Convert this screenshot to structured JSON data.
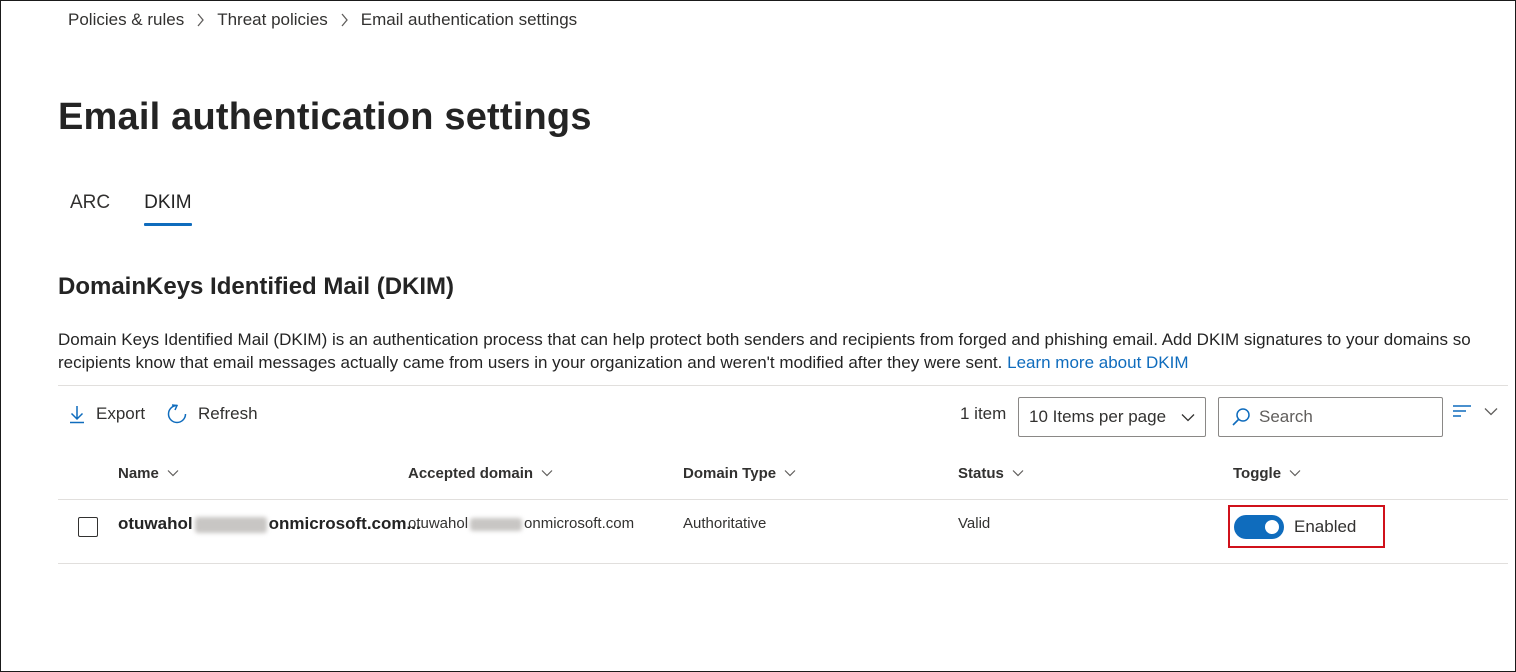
{
  "breadcrumb": {
    "items": [
      "Policies & rules",
      "Threat policies",
      "Email authentication settings"
    ]
  },
  "page": {
    "title": "Email authentication settings"
  },
  "tabs": [
    {
      "label": "ARC",
      "active": false
    },
    {
      "label": "DKIM",
      "active": true
    }
  ],
  "section": {
    "title": "DomainKeys Identified Mail (DKIM)",
    "description": "Domain Keys Identified Mail (DKIM) is an authentication process that can help protect both senders and recipients from forged and phishing email. Add DKIM signatures to your domains so recipients know that email messages actually came from users in your organization and weren't modified after they were sent.",
    "learn_more": "Learn more about DKIM"
  },
  "toolbar": {
    "export_label": "Export",
    "refresh_label": "Refresh",
    "item_count": "1 item",
    "per_page": "10 Items per page",
    "search_placeholder": "Search"
  },
  "table": {
    "columns": [
      "Name",
      "Accepted domain",
      "Domain Type",
      "Status",
      "Toggle"
    ],
    "rows": [
      {
        "name_prefix": "otuwahol",
        "name_suffix": "onmicrosoft.com...",
        "domain_prefix": "otuwahol",
        "domain_suffix": "onmicrosoft.com",
        "domain_type": "Authoritative",
        "status": "Valid",
        "toggle_label": "Enabled",
        "toggle_on": true
      }
    ]
  },
  "colors": {
    "accent": "#0f6cbd",
    "highlight_box": "#d0111b"
  }
}
